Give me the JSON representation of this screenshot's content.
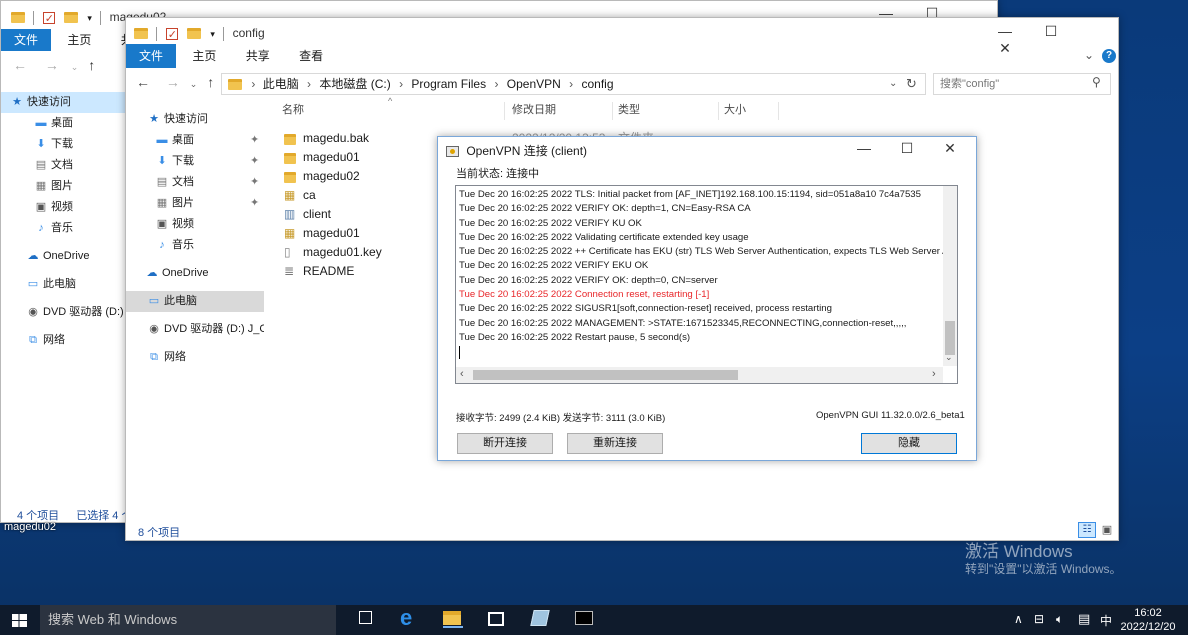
{
  "back_window": {
    "title": "magedu02",
    "ribbon_tabs": [
      "文件",
      "主页",
      "共享"
    ],
    "nav": [
      "快速访问",
      "桌面",
      "下载",
      "文档",
      "图片",
      "视频",
      "音乐",
      "OneDrive",
      "此电脑",
      "DVD 驱动器 (D:) J",
      "网络"
    ],
    "status_count": "4 个项目",
    "status_selected": "已选择 4 个"
  },
  "desktop_label": "magedu02",
  "explorer": {
    "title": "config",
    "ribbon_tabs": [
      "文件",
      "主页",
      "共享",
      "查看"
    ],
    "breadcrumb": [
      "此电脑",
      "本地磁盘 (C:)",
      "Program Files",
      "OpenVPN",
      "config"
    ],
    "search_placeholder": "搜索\"config\"",
    "columns": {
      "name": "名称",
      "date": "修改日期",
      "type": "类型",
      "size": "大小"
    },
    "partial_date": "2022/12/20 13:53",
    "partial_type": "文件夹",
    "nav": [
      "快速访问",
      "桌面",
      "下载",
      "文档",
      "图片",
      "视频",
      "音乐",
      "OneDrive",
      "此电脑",
      "DVD 驱动器 (D:) J_C",
      "网络"
    ],
    "files": [
      "magedu.bak",
      "magedu01",
      "magedu02",
      "ca",
      "client",
      "magedu01",
      "magedu01.key",
      "README"
    ],
    "status_count": "8 个项目"
  },
  "vpn": {
    "title": "OpenVPN 连接 (client)",
    "status": "当前状态: 连接中",
    "log": [
      "Tue Dec 20 16:02:25 2022 TLS: Initial packet from [AF_INET]192.168.100.15:1194, sid=051a8a10 7c4a7535",
      "Tue Dec 20 16:02:25 2022 VERIFY OK: depth=1, CN=Easy-RSA CA",
      "Tue Dec 20 16:02:25 2022 VERIFY KU OK",
      "Tue Dec 20 16:02:25 2022 Validating certificate extended key usage",
      "Tue Dec 20 16:02:25 2022 ++ Certificate has EKU (str) TLS Web Server Authentication, expects TLS Web Server Auth",
      "Tue Dec 20 16:02:25 2022 VERIFY EKU OK",
      "Tue Dec 20 16:02:25 2022 VERIFY OK: depth=0, CN=server",
      "Tue Dec 20 16:02:25 2022 Connection reset, restarting [-1]",
      "Tue Dec 20 16:02:25 2022 SIGUSR1[soft,connection-reset] received, process restarting",
      "Tue Dec 20 16:02:25 2022 MANAGEMENT: >STATE:1671523345,RECONNECTING,connection-reset,,,,,",
      "Tue Dec 20 16:02:25 2022 Restart pause, 5 second(s)"
    ],
    "bytes": "接收字节: 2499 (2.4 KiB) 发送字节: 3111 (3.0 KiB)",
    "version": "OpenVPN GUI 11.32.0.0/2.6_beta1",
    "disconnect_label": "断开连接",
    "reconnect_label": "重新连接",
    "hide_label": "隐藏",
    "error_color": "#e8262a"
  },
  "watermark": {
    "line1": "激活 Windows",
    "line2": "转到\"设置\"以激活 Windows。"
  },
  "taskbar": {
    "search_placeholder": "搜索 Web 和 Windows",
    "time": "16:02",
    "date": "2022/12/20",
    "ime": "中"
  }
}
